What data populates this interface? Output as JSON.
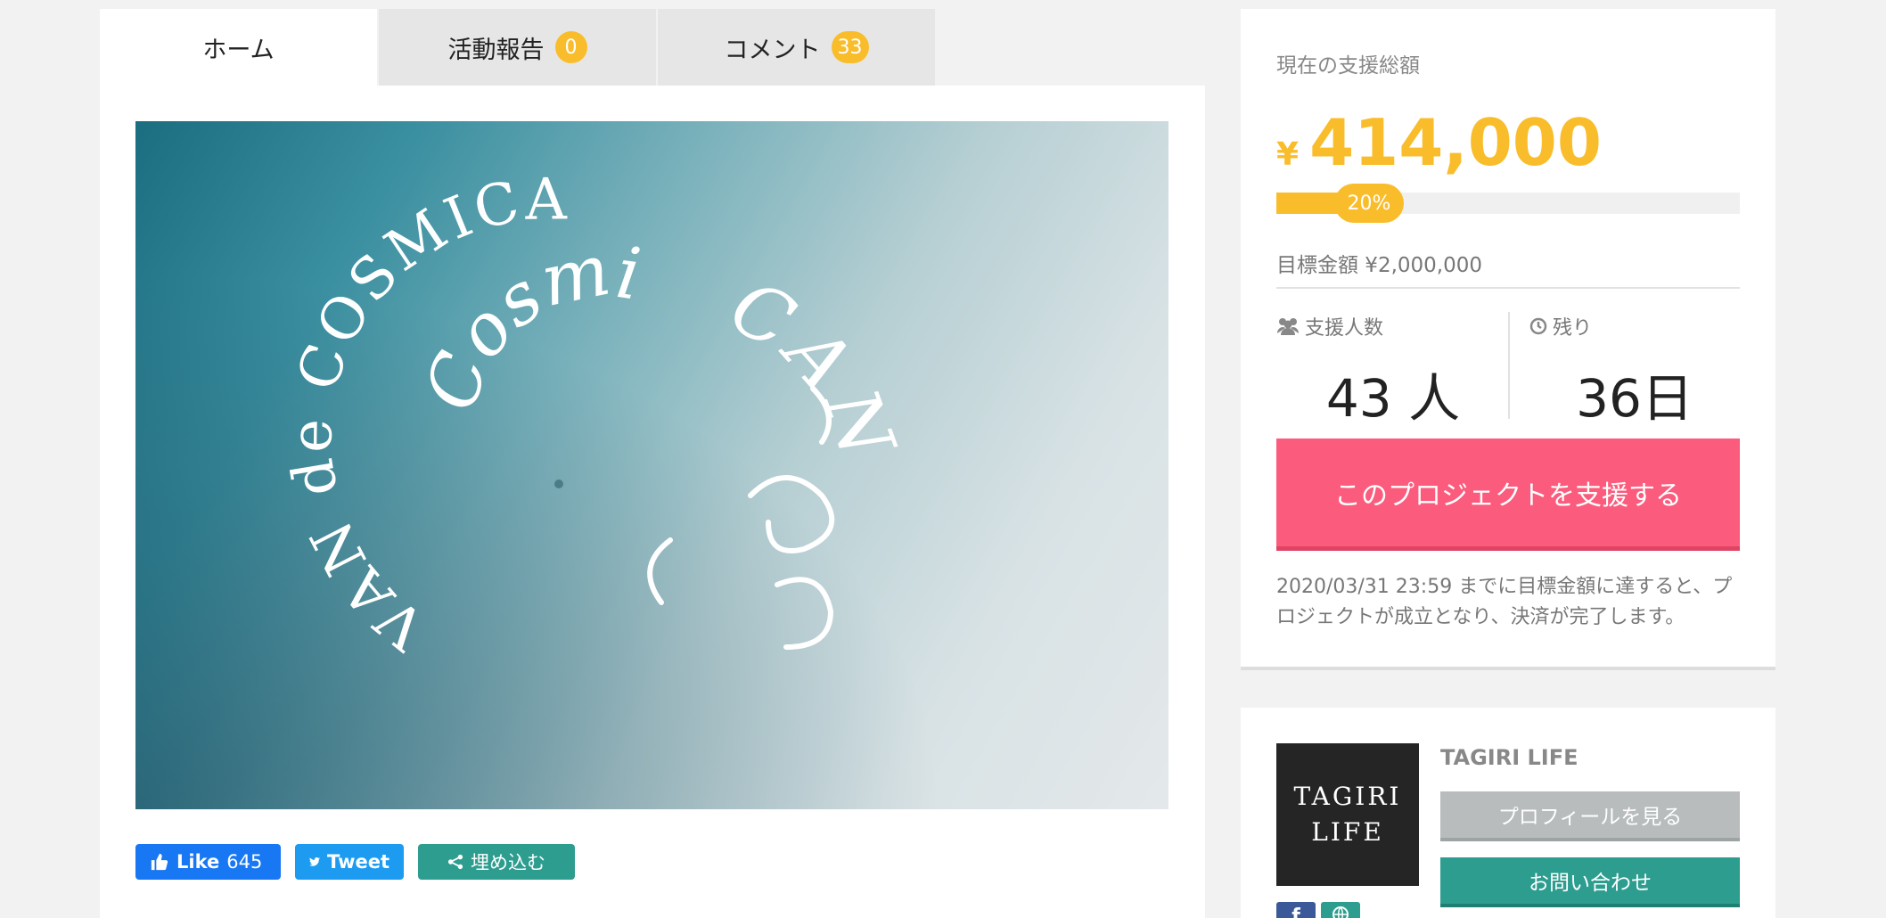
{
  "tabs": [
    {
      "label": "ホーム",
      "badge": null
    },
    {
      "label": "活動報告",
      "badge": "0"
    },
    {
      "label": "コメント",
      "badge": "33"
    }
  ],
  "hero": {
    "logo_text_outer": "VAN de COSMICA",
    "logo_text_mid": "Cosmic",
    "logo_text_inner": "CAN"
  },
  "share": {
    "like_label": "Like",
    "like_count": "645",
    "tweet_label": "Tweet",
    "embed_label": "埋め込む"
  },
  "funding": {
    "total_label": "現在の支援総額",
    "currency": "¥",
    "amount": "414,000",
    "progress_label": "20%",
    "progress_fraction": 0.2,
    "goal_label": "目標金額 ¥2,000,000",
    "supporters_label": "支援人数",
    "supporters_value": "43 人",
    "remaining_label": "残り",
    "remaining_value": "36日",
    "cta_label": "このプロジェクトを支援する",
    "note": "2020/03/31 23:59 までに目標金額に達すると、プロジェクトが成立となり、決済が完了します。"
  },
  "owner": {
    "logo_line1": "TAGIRI",
    "logo_line2": "LIFE",
    "name": "TAGIRI LIFE",
    "profile_button": "プロフィールを見る",
    "contact_button": "お問い合わせ",
    "sns_fb": "f"
  },
  "colors": {
    "accent": "#f9bd2b",
    "cta": "#fb5b7c",
    "teal": "#2d9d8f",
    "facebook": "#1877f2",
    "twitter": "#1d9bf0"
  }
}
